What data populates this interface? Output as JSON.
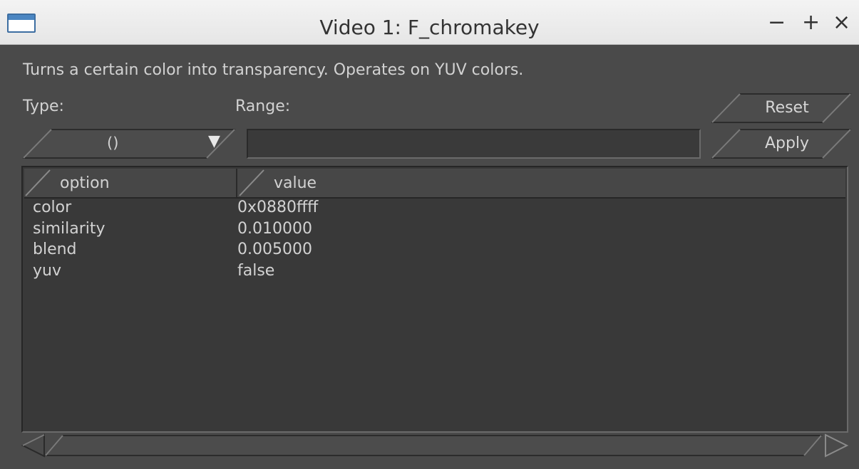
{
  "window": {
    "title": "Video 1: F_chromakey",
    "minimize": "−",
    "maximize": "+",
    "close": "×"
  },
  "description": "Turns a certain color into transparency. Operates on YUV colors.",
  "labels": {
    "type": "Type:",
    "range": "Range:"
  },
  "type_select": {
    "value": "()"
  },
  "range_input": {
    "value": ""
  },
  "buttons": {
    "reset": "Reset",
    "apply": "Apply"
  },
  "table": {
    "columns": [
      "option",
      "value"
    ],
    "rows": [
      {
        "option": "color",
        "value": "0x0880ffff"
      },
      {
        "option": "similarity",
        "value": "0.010000"
      },
      {
        "option": "blend",
        "value": "0.005000"
      },
      {
        "option": "yuv",
        "value": "false"
      }
    ]
  }
}
